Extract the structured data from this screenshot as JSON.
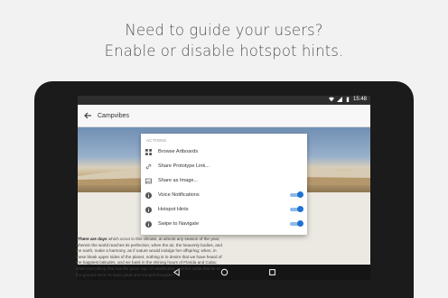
{
  "headline": {
    "line1": "Need to guide your users?",
    "line2": "Enable or disable hotspot hints."
  },
  "status_bar": {
    "time": "15:48",
    "icons": [
      "wifi-icon",
      "signal-icon",
      "battery-icon"
    ]
  },
  "app_bar": {
    "back_icon": "arrow-left-icon",
    "title": "Campvibes"
  },
  "content": {
    "quote_lead": "\"There are days",
    "quote_rest": " which occur in this climate, at almost any season of the year, wherein the world reaches its perfection, when the air, the heavenly bodies, and the earth, make a harmony, as if nature would indulge her offspring; when, in these bleak upper sides of the planet, nothing is to desire that we have heard of the happiest latitudes, and we bask in the shining hours of Florida and Cuba; when everything that has life gives sign of satisfaction, and the cattle that lie on the ground seem to have great and tranquil thoughts.\""
  },
  "menu": {
    "section_label": "ACTIONS",
    "items": [
      {
        "label": "Browse Artboards",
        "icon": "grid-icon"
      },
      {
        "label": "Share Prototype Link...",
        "icon": "link-icon"
      },
      {
        "label": "Share as Image...",
        "icon": "image-icon"
      },
      {
        "label": "Voice Notifications",
        "icon": "info-icon",
        "toggle": true
      },
      {
        "label": "Hotspot Hints",
        "icon": "info-icon",
        "toggle": true
      },
      {
        "label": "Swipe to Navigate",
        "icon": "info-icon",
        "toggle": true
      }
    ]
  },
  "colors": {
    "accent": "#1e73d2",
    "toggle_track": "#8fb9e8",
    "bezel": "#1b1b1b"
  },
  "nav_bar": {
    "icons": [
      "back-triangle-icon",
      "home-circle-icon",
      "recents-square-icon"
    ]
  }
}
